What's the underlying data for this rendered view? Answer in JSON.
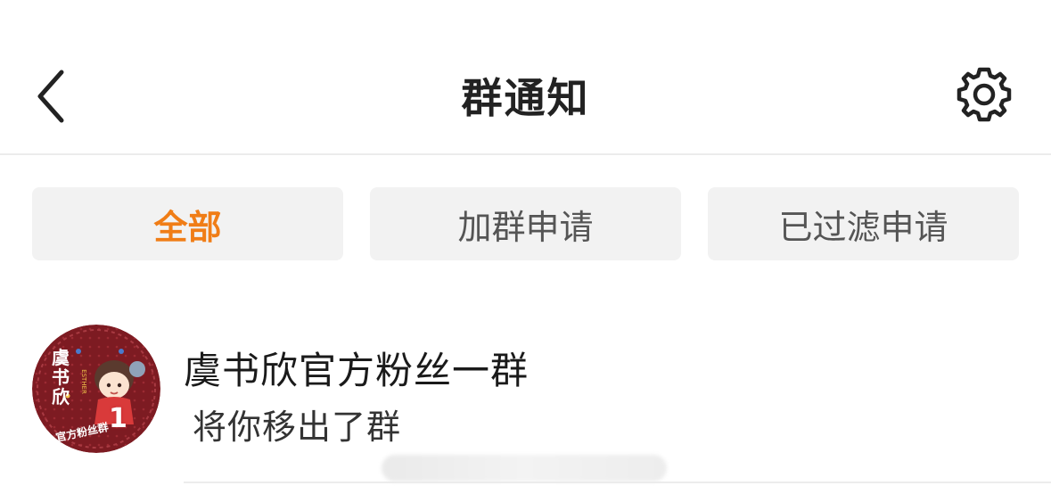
{
  "header": {
    "title": "群通知",
    "back_icon": "chevron-left-icon",
    "settings_icon": "gear-icon"
  },
  "tabs": [
    {
      "label": "全部",
      "active": true
    },
    {
      "label": "加群申请",
      "active": false
    },
    {
      "label": "已过滤申请",
      "active": false
    }
  ],
  "notice": {
    "group_name": "虞书欣官方粉丝一群",
    "message": "将你移出了群",
    "avatar": {
      "text_main": "虞书欣",
      "text_sub": "官方粉丝群",
      "text_en": "ESTHER",
      "number": "1"
    }
  },
  "colors": {
    "accent": "#f07d16",
    "tab_bg": "#f2f2f2",
    "avatar_bg": "#7d1b22"
  }
}
